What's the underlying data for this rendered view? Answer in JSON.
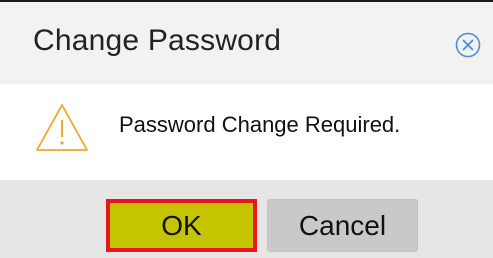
{
  "dialog": {
    "title": "Change Password",
    "close_icon": "close-circle-icon",
    "warning_icon": "warning-triangle-icon",
    "message": "Password Change Required.",
    "ok_label": "OK",
    "cancel_label": "Cancel"
  },
  "colors": {
    "header_bg": "#f2f2f2",
    "footer_bg": "#e6e6e6",
    "ok_bg": "#c4c400",
    "ok_highlight_border": "#e8161e",
    "cancel_bg": "#c9c9c9",
    "close_icon": "#4a90d9",
    "warning_icon": "#f0a830"
  }
}
